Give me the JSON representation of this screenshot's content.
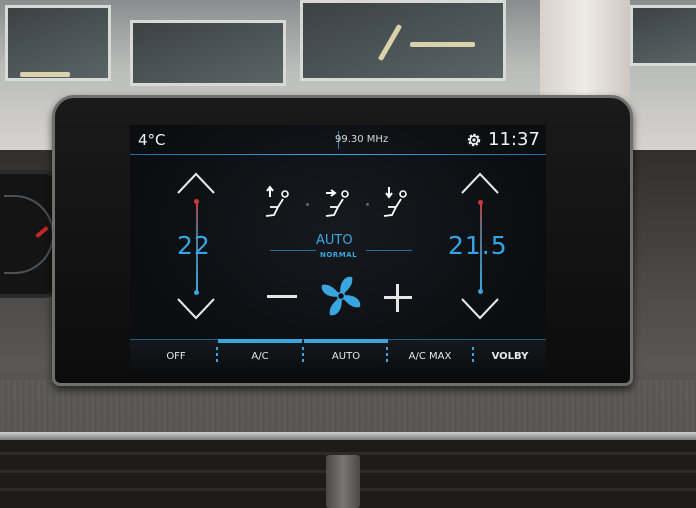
{
  "status_bar": {
    "outside_temp": "4°C",
    "radio_frequency": "99.30 MHz",
    "clock": "11:37",
    "settings_icon": "gear-icon"
  },
  "climate": {
    "left_temp": "22",
    "right_temp": "21.5",
    "mode": "AUTO",
    "mode_level": "NORMAL",
    "air_distribution_icons": [
      "seat-airflow-face-icon",
      "seat-airflow-body-icon",
      "seat-airflow-feet-icon"
    ],
    "fan_icon": "fan-icon"
  },
  "bottom_bar": {
    "off_label": "OFF",
    "ac_label": "A/C",
    "auto_label": "AUTO",
    "ac_max_label": "A/C MAX",
    "volby_label": "VOLBY"
  },
  "colors": {
    "accent": "#3aa6e0",
    "hot": "#d23737"
  }
}
